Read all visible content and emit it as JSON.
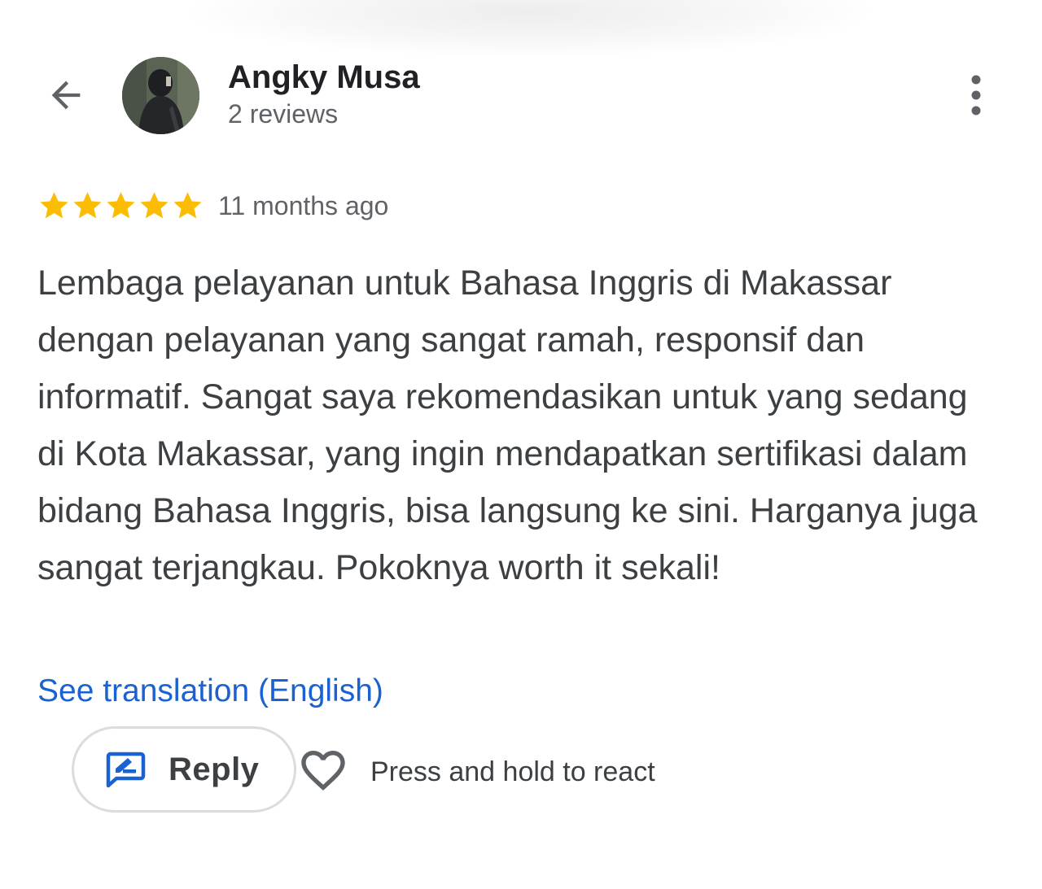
{
  "header": {
    "back_icon": "arrow-left-icon",
    "user_name": "Angky Musa",
    "review_count": "2 reviews",
    "more_icon": "more-vertical-icon"
  },
  "review": {
    "rating": 5,
    "rating_max": 5,
    "date": "11 months ago",
    "text": "Lembaga pelayanan untuk Bahasa Inggris di Makassar dengan pelayanan yang sangat ramah, responsif dan informatif. Sangat saya rekomendasikan untuk yang sedang di Kota Makassar, yang ingin mendapatkan sertifikasi dalam bidang Bahasa Inggris, bisa langsung ke sini. Harganya juga sangat terjangkau. Pokoknya worth it sekali!",
    "translate_link": "See translation (English)"
  },
  "actions": {
    "reply_label": "Reply",
    "reply_icon": "reply-edit-icon",
    "react_icon": "heart-outline-icon",
    "react_hint": "Press and hold to react"
  },
  "colors": {
    "star": "#fbbc04",
    "link": "#1a62d1",
    "reply_icon": "#1a62d1",
    "secondary_text": "#5f6368",
    "body_text": "#3c4043"
  }
}
